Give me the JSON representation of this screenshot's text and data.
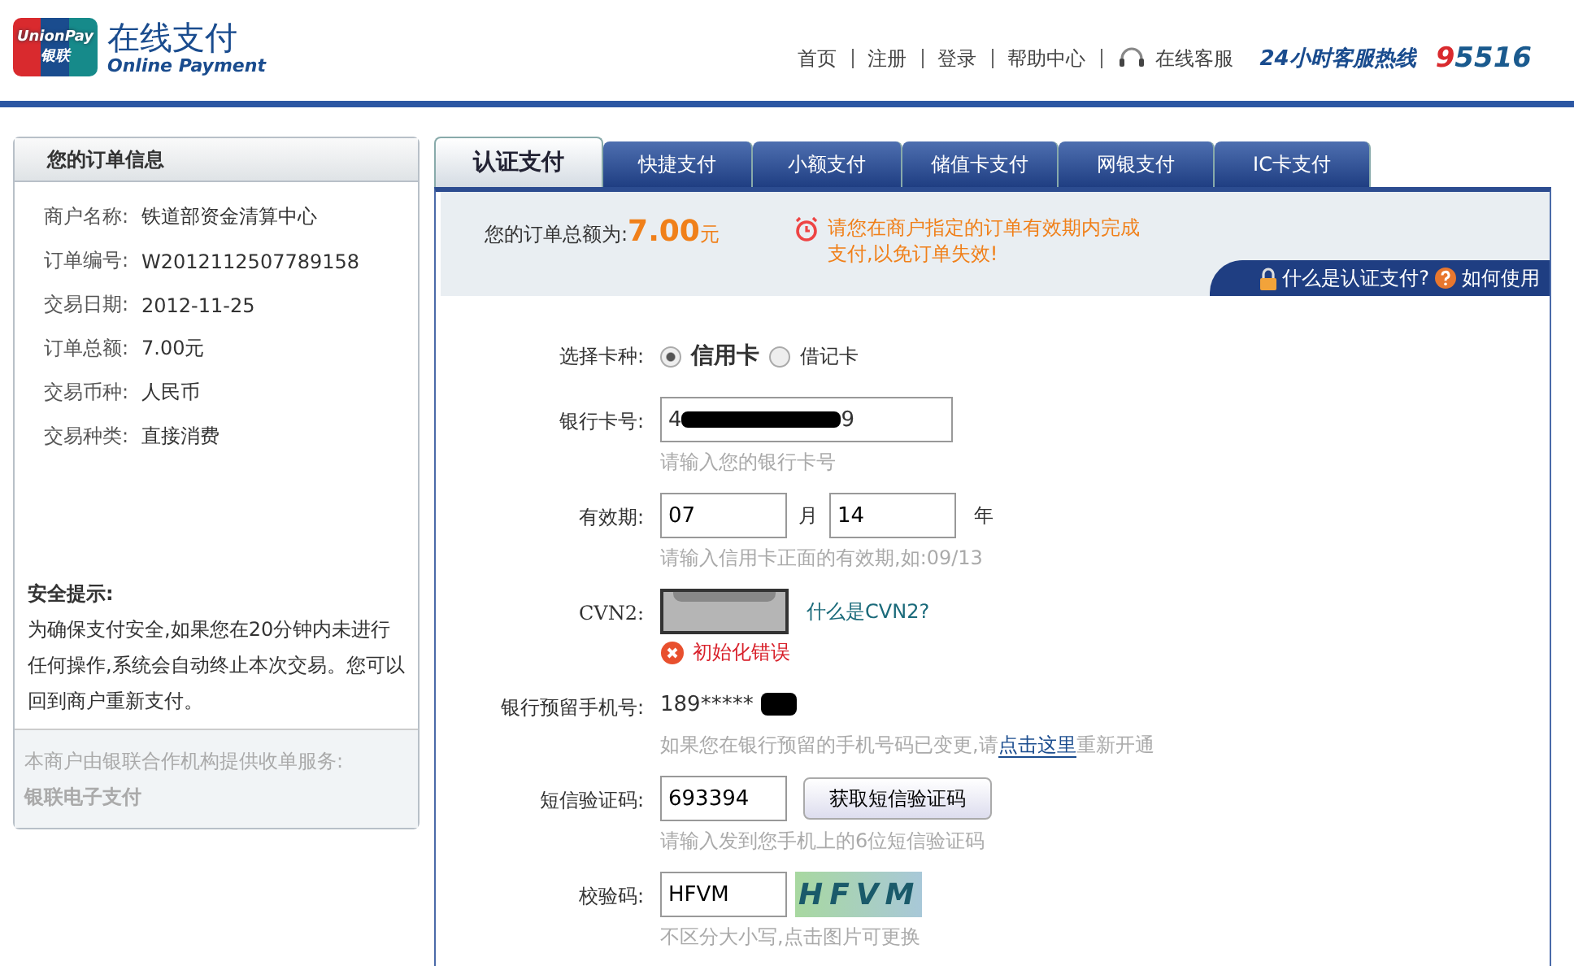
{
  "logo": {
    "mark_top": "UnionPay",
    "mark_bottom": "银联",
    "title": "在线支付",
    "subtitle": "Online Payment"
  },
  "top_nav": [
    {
      "label": "首页"
    },
    {
      "label": "注册"
    },
    {
      "label": "登录"
    },
    {
      "label": "帮助中心"
    }
  ],
  "support": {
    "label": "在线客服",
    "hotline_label": "24小时客服热线",
    "hotline_digit": "9",
    "hotline_rest": "5516"
  },
  "order_panel": {
    "title": "您的订单信息",
    "fields": [
      {
        "label": "商户名称:",
        "value": "铁道部资金清算中心"
      },
      {
        "label": "订单编号:",
        "value": "W2012112507789158"
      },
      {
        "label": "交易日期:",
        "value": "2012-11-25"
      },
      {
        "label": "订单总额:",
        "value": "7.00元"
      },
      {
        "label": "交易币种:",
        "value": "人民币"
      },
      {
        "label": "交易种类:",
        "value": "直接消费"
      }
    ],
    "tip_title": "安全提示:",
    "tip_text": "为确保支付安全,如果您在20分钟内未进行任何操作,系统会自动终止本次交易。您可以回到商户重新支付。",
    "acquirer_note": "本商户由银联合作机构提供收单服务:",
    "acquirer": "银联电子支付"
  },
  "tabs": [
    {
      "label": "认证支付",
      "selected": true
    },
    {
      "label": "快捷支付",
      "selected": false
    },
    {
      "label": "小额支付",
      "selected": false
    },
    {
      "label": "储值卡支付",
      "selected": false
    },
    {
      "label": "网银支付",
      "selected": false
    },
    {
      "label": "IC卡支付",
      "selected": false
    }
  ],
  "summary": {
    "label": "您的订单总额为:",
    "amount": "7.00",
    "unit": "元",
    "warning": "请您在商户指定的订单有效期内完成支付,以免订单失效!",
    "help_link": "什么是认证支付?",
    "usage_link": "如何使用"
  },
  "form": {
    "card_type": {
      "label": "选择卡种:",
      "options": [
        {
          "label": "信用卡",
          "selected": true
        },
        {
          "label": "借记卡",
          "selected": false
        }
      ]
    },
    "card_number": {
      "label": "银行卡号:",
      "value_start": "4",
      "value_end": "9",
      "hint": "请输入您的银行卡号"
    },
    "expiry": {
      "label": "有效期:",
      "month": "07",
      "month_unit": "月",
      "year": "14",
      "year_unit": "年",
      "hint": "请输入信用卡正面的有效期,如:09/13"
    },
    "cvn": {
      "label": "CVN2:",
      "help_link": "什么是CVN2?",
      "error": "初始化错误"
    },
    "phone": {
      "label": "银行预留手机号:",
      "value": "189*****",
      "hint_before": "如果您在银行预留的手机号码已变更,请",
      "hint_link": "点击这里",
      "hint_after": "重新开通"
    },
    "sms": {
      "label": "短信验证码:",
      "value": "693394",
      "button": "获取短信验证码",
      "hint": "请输入发到您手机上的6位短信验证码"
    },
    "captcha": {
      "label": "校验码:",
      "value": "HFVM",
      "image_text": "HFVM",
      "hint": "不区分大小写,点击图片可更换"
    }
  }
}
